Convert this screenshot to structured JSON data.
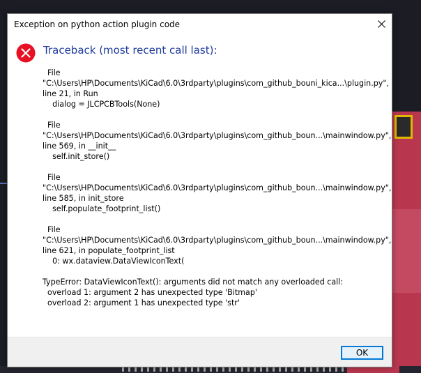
{
  "dialog": {
    "title": "Exception on python action plugin code",
    "heading": "Traceback (most recent call last):",
    "traceback_lines": [
      "  File",
      "\"C:\\Users\\HP\\Documents\\KiCad\\6.0\\3rdparty\\plugins\\com_github_bouni_kica...\\plugin.py\",",
      "line 21, in Run",
      "    dialog = JLCPCBTools(None)",
      "",
      "  File",
      "\"C:\\Users\\HP\\Documents\\KiCad\\6.0\\3rdparty\\plugins\\com_github_boun...\\mainwindow.py\",",
      "line 569, in __init__",
      "    self.init_store()",
      "",
      "  File",
      "\"C:\\Users\\HP\\Documents\\KiCad\\6.0\\3rdparty\\plugins\\com_github_boun...\\mainwindow.py\",",
      "line 585, in init_store",
      "    self.populate_footprint_list()",
      "",
      "  File",
      "\"C:\\Users\\HP\\Documents\\KiCad\\6.0\\3rdparty\\plugins\\com_github_boun...\\mainwindow.py\",",
      "line 621, in populate_footprint_list",
      "    0: wx.dataview.DataViewIconText(",
      "",
      "TypeError: DataViewIconText(): arguments did not match any overloaded call:",
      "  overload 1: argument 2 has unexpected type 'Bitmap'",
      "  overload 2: argument 1 has unexpected type 'str'"
    ],
    "ok_label": "OK"
  },
  "icons": {
    "error": "error-circle-icon",
    "close": "close-icon"
  },
  "colors": {
    "heading": "#1e3a9e",
    "error_icon": "#e81123",
    "ok_border": "#0078d7"
  }
}
